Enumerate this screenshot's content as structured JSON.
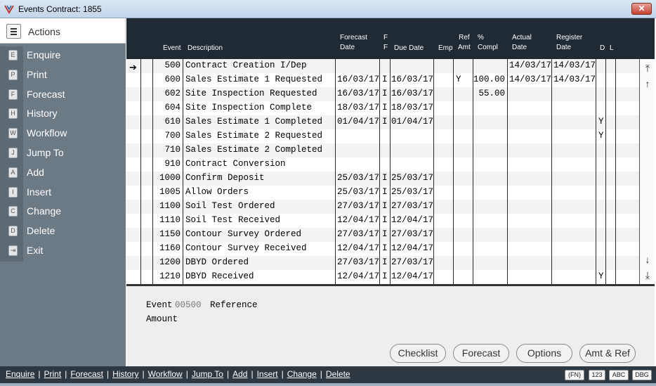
{
  "window": {
    "title": "Events  Contract: 1855",
    "close_glyph": "✕"
  },
  "actions": {
    "header": "Actions",
    "items": [
      {
        "key": "E",
        "label": "Enquire"
      },
      {
        "key": "P",
        "label": "Print"
      },
      {
        "key": "F",
        "label": "Forecast"
      },
      {
        "key": "H",
        "label": "History"
      },
      {
        "key": "W",
        "label": "Workflow"
      },
      {
        "key": "J",
        "label": "Jump To"
      },
      {
        "key": "A",
        "label": "Add"
      },
      {
        "key": "I",
        "label": "Insert"
      },
      {
        "key": "C",
        "label": "Change"
      },
      {
        "key": "D",
        "label": "Delete"
      },
      {
        "key": "⇥",
        "label": "Exit"
      }
    ]
  },
  "grid": {
    "headers": {
      "event": "Event",
      "description": "Description",
      "forecast_date": "Forecast\nDate",
      "ff": "F\nF",
      "due_date": "Due Date",
      "emp": "Emp",
      "ref_amt": "Ref\nAmt",
      "pct_compl": "%\nCompl",
      "actual_date": "Actual\nDate",
      "register_date": "Register\nDate",
      "d": "D",
      "l": "L"
    },
    "rows": [
      {
        "event": "500",
        "desc": "Contract Creation I/Dep",
        "forecast": "",
        "f": "",
        "due": "",
        "ref": "",
        "pct": "",
        "actual": "14/03/17",
        "register": "14/03/17",
        "d": ""
      },
      {
        "event": "600",
        "desc": "Sales Estimate 1 Requested",
        "forecast": "16/03/17",
        "f": "I",
        "due": "16/03/17",
        "ref": "Y",
        "pct": "100.00",
        "actual": "14/03/17",
        "register": "14/03/17",
        "d": ""
      },
      {
        "event": "602",
        "desc": "Site Inspection Requested",
        "forecast": "16/03/17",
        "f": "I",
        "due": "16/03/17",
        "ref": "",
        "pct": "55.00",
        "actual": "",
        "register": "",
        "d": ""
      },
      {
        "event": "604",
        "desc": "Site Inspection Complete",
        "forecast": "18/03/17",
        "f": "I",
        "due": "18/03/17",
        "ref": "",
        "pct": "",
        "actual": "",
        "register": "",
        "d": ""
      },
      {
        "event": "610",
        "desc": "Sales Estimate 1 Completed",
        "forecast": "01/04/17",
        "f": "I",
        "due": "01/04/17",
        "ref": "",
        "pct": "",
        "actual": "",
        "register": "",
        "d": "Y"
      },
      {
        "event": "700",
        "desc": "Sales Estimate 2 Requested",
        "forecast": "",
        "f": "",
        "due": "",
        "ref": "",
        "pct": "",
        "actual": "",
        "register": "",
        "d": "Y"
      },
      {
        "event": "710",
        "desc": "Sales Estimate 2 Completed",
        "forecast": "",
        "f": "",
        "due": "",
        "ref": "",
        "pct": "",
        "actual": "",
        "register": "",
        "d": ""
      },
      {
        "event": "910",
        "desc": "Contract Conversion",
        "forecast": "",
        "f": "",
        "due": "",
        "ref": "",
        "pct": "",
        "actual": "",
        "register": "",
        "d": ""
      },
      {
        "event": "1000",
        "desc": "Confirm Deposit",
        "forecast": "25/03/17",
        "f": "I",
        "due": "25/03/17",
        "ref": "",
        "pct": "",
        "actual": "",
        "register": "",
        "d": ""
      },
      {
        "event": "1005",
        "desc": "Allow Orders",
        "forecast": "25/03/17",
        "f": "I",
        "due": "25/03/17",
        "ref": "",
        "pct": "",
        "actual": "",
        "register": "",
        "d": ""
      },
      {
        "event": "1100",
        "desc": "Soil Test Ordered",
        "forecast": "27/03/17",
        "f": "I",
        "due": "27/03/17",
        "ref": "",
        "pct": "",
        "actual": "",
        "register": "",
        "d": ""
      },
      {
        "event": "1110",
        "desc": "Soil Test Received",
        "forecast": "12/04/17",
        "f": "I",
        "due": "12/04/17",
        "ref": "",
        "pct": "",
        "actual": "",
        "register": "",
        "d": ""
      },
      {
        "event": "1150",
        "desc": "Contour Survey Ordered",
        "forecast": "27/03/17",
        "f": "I",
        "due": "27/03/17",
        "ref": "",
        "pct": "",
        "actual": "",
        "register": "",
        "d": ""
      },
      {
        "event": "1160",
        "desc": "Contour Survey Received",
        "forecast": "12/04/17",
        "f": "I",
        "due": "12/04/17",
        "ref": "",
        "pct": "",
        "actual": "",
        "register": "",
        "d": ""
      },
      {
        "event": "1200",
        "desc": "DBYD Ordered",
        "forecast": "27/03/17",
        "f": "I",
        "due": "27/03/17",
        "ref": "",
        "pct": "",
        "actual": "",
        "register": "",
        "d": ""
      },
      {
        "event": "1210",
        "desc": "DBYD Received",
        "forecast": "12/04/17",
        "f": "I",
        "due": "12/04/17",
        "ref": "",
        "pct": "",
        "actual": "",
        "register": "",
        "d": "Y"
      }
    ],
    "pointer": "➔",
    "scroll": {
      "top": "⤒",
      "up": "↑",
      "down": "↓",
      "bottom": "⤓"
    }
  },
  "detail": {
    "event_label": "Event",
    "event_value": "00500",
    "reference_label": "Reference",
    "amount_label": "Amount"
  },
  "buttons": {
    "checklist": "Checklist",
    "forecast": "Forecast",
    "options": "Options",
    "amt_ref": "Amt & Ref"
  },
  "statusbar": {
    "links": [
      "Enquire",
      "Print",
      "Forecast",
      "History",
      "Workflow",
      "Jump To",
      "Add",
      "Insert",
      "Change",
      "Delete"
    ],
    "separator": "|",
    "badges": [
      "(FN)",
      "123",
      "ABC",
      "DBG"
    ]
  }
}
